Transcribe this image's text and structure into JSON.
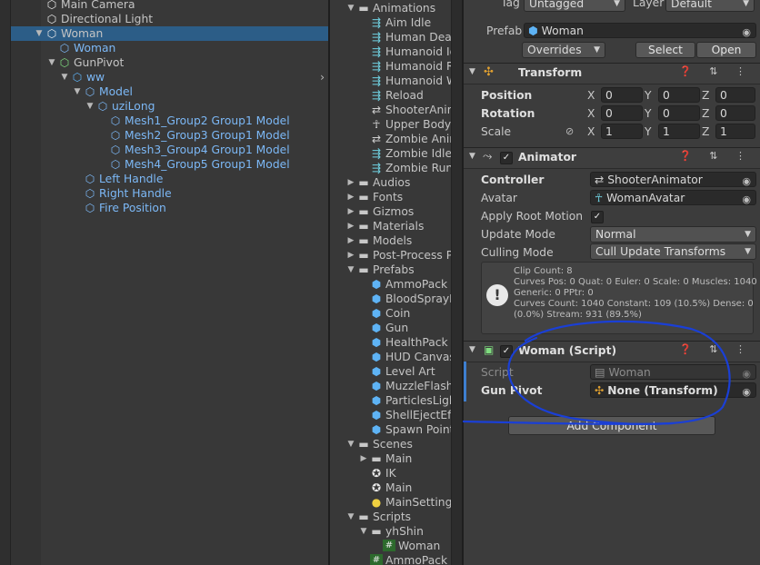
{
  "hierarchy": {
    "items": [
      {
        "label": "Main Camera",
        "indent": 0,
        "arrow": "",
        "icon": "cube",
        "blue": false,
        "selected": false
      },
      {
        "label": "Directional Light",
        "indent": 0,
        "arrow": "",
        "icon": "cube",
        "blue": false,
        "selected": false
      },
      {
        "label": "Woman",
        "indent": 0,
        "arrow": "▼",
        "icon": "cube",
        "blue": false,
        "selected": true
      },
      {
        "label": "Woman",
        "indent": 1,
        "arrow": "",
        "icon": "cube",
        "blue": true,
        "selected": false
      },
      {
        "label": "GunPivot",
        "indent": 1,
        "arrow": "▼",
        "icon": "cube-script",
        "blue": false,
        "selected": false
      },
      {
        "label": "ww",
        "indent": 2,
        "arrow": "▼",
        "icon": "cube-blue",
        "blue": true,
        "selected": false
      },
      {
        "label": "Model",
        "indent": 3,
        "arrow": "▼",
        "icon": "cube",
        "blue": true,
        "selected": false
      },
      {
        "label": "uziLong",
        "indent": 4,
        "arrow": "▼",
        "icon": "cube",
        "blue": true,
        "selected": false
      },
      {
        "label": "Mesh1_Group2 Group1 Model",
        "indent": 5,
        "arrow": "",
        "icon": "cube",
        "blue": true,
        "selected": false
      },
      {
        "label": "Mesh2_Group3 Group1 Model",
        "indent": 5,
        "arrow": "",
        "icon": "cube",
        "blue": true,
        "selected": false
      },
      {
        "label": "Mesh3_Group4 Group1 Model",
        "indent": 5,
        "arrow": "",
        "icon": "cube",
        "blue": true,
        "selected": false
      },
      {
        "label": "Mesh4_Group5 Group1 Model",
        "indent": 5,
        "arrow": "",
        "icon": "cube",
        "blue": true,
        "selected": false
      },
      {
        "label": "Left Handle",
        "indent": 3,
        "arrow": "",
        "icon": "cube",
        "blue": true,
        "selected": false
      },
      {
        "label": "Right Handle",
        "indent": 3,
        "arrow": "",
        "icon": "cube",
        "blue": true,
        "selected": false
      },
      {
        "label": "Fire Position",
        "indent": 3,
        "arrow": "",
        "icon": "cube",
        "blue": true,
        "selected": false
      }
    ],
    "expand_arrow": "›"
  },
  "project": {
    "items": [
      {
        "label": "Animations",
        "indent": 0,
        "arrow": "▼",
        "icon": "folder"
      },
      {
        "label": "Aim Idle",
        "indent": 1,
        "arrow": "",
        "icon": "anim"
      },
      {
        "label": "Human Deat",
        "indent": 1,
        "arrow": "",
        "icon": "anim"
      },
      {
        "label": "Humanoid Id",
        "indent": 1,
        "arrow": "",
        "icon": "anim"
      },
      {
        "label": "Humanoid R",
        "indent": 1,
        "arrow": "",
        "icon": "anim"
      },
      {
        "label": "Humanoid W",
        "indent": 1,
        "arrow": "",
        "icon": "anim"
      },
      {
        "label": "Reload",
        "indent": 1,
        "arrow": "",
        "icon": "anim"
      },
      {
        "label": "ShooterAnim",
        "indent": 1,
        "arrow": "",
        "icon": "animator"
      },
      {
        "label": "Upper Body",
        "indent": 1,
        "arrow": "",
        "icon": "avatar"
      },
      {
        "label": "Zombie Anim",
        "indent": 1,
        "arrow": "",
        "icon": "animator"
      },
      {
        "label": "Zombie Idle",
        "indent": 1,
        "arrow": "",
        "icon": "anim"
      },
      {
        "label": "Zombie Run",
        "indent": 1,
        "arrow": "",
        "icon": "anim"
      },
      {
        "label": "Audios",
        "indent": 0,
        "arrow": "▶",
        "icon": "folder"
      },
      {
        "label": "Fonts",
        "indent": 0,
        "arrow": "▶",
        "icon": "folder"
      },
      {
        "label": "Gizmos",
        "indent": 0,
        "arrow": "▶",
        "icon": "folder"
      },
      {
        "label": "Materials",
        "indent": 0,
        "arrow": "▶",
        "icon": "folder"
      },
      {
        "label": "Models",
        "indent": 0,
        "arrow": "▶",
        "icon": "folder"
      },
      {
        "label": "Post-Process P",
        "indent": 0,
        "arrow": "▶",
        "icon": "folder"
      },
      {
        "label": "Prefabs",
        "indent": 0,
        "arrow": "▼",
        "icon": "folder"
      },
      {
        "label": "AmmoPack",
        "indent": 1,
        "arrow": "",
        "icon": "prefab"
      },
      {
        "label": "BloodSprayE",
        "indent": 1,
        "arrow": "",
        "icon": "prefab"
      },
      {
        "label": "Coin",
        "indent": 1,
        "arrow": "",
        "icon": "prefab"
      },
      {
        "label": "Gun",
        "indent": 1,
        "arrow": "",
        "icon": "prefab"
      },
      {
        "label": "HealthPack",
        "indent": 1,
        "arrow": "",
        "icon": "prefab"
      },
      {
        "label": "HUD Canvas",
        "indent": 1,
        "arrow": "",
        "icon": "prefab"
      },
      {
        "label": "Level Art",
        "indent": 1,
        "arrow": "",
        "icon": "prefab"
      },
      {
        "label": "MuzzleFlash",
        "indent": 1,
        "arrow": "",
        "icon": "prefab"
      },
      {
        "label": "ParticlesLigh",
        "indent": 1,
        "arrow": "",
        "icon": "prefab"
      },
      {
        "label": "ShellEjectEff",
        "indent": 1,
        "arrow": "",
        "icon": "prefab"
      },
      {
        "label": "Spawn Point",
        "indent": 1,
        "arrow": "",
        "icon": "prefab"
      },
      {
        "label": "Scenes",
        "indent": 0,
        "arrow": "▼",
        "icon": "folder"
      },
      {
        "label": "Main",
        "indent": 1,
        "arrow": "▶",
        "icon": "folder"
      },
      {
        "label": "IK",
        "indent": 1,
        "arrow": "",
        "icon": "unity"
      },
      {
        "label": "Main",
        "indent": 1,
        "arrow": "",
        "icon": "unity"
      },
      {
        "label": "MainSetting",
        "indent": 1,
        "arrow": "",
        "icon": "bulb"
      },
      {
        "label": "Scripts",
        "indent": 0,
        "arrow": "▼",
        "icon": "folder"
      },
      {
        "label": "yhShin",
        "indent": 1,
        "arrow": "▼",
        "icon": "folder"
      },
      {
        "label": "Woman",
        "indent": 2,
        "arrow": "",
        "icon": "script"
      },
      {
        "label": "AmmoPack",
        "indent": 1,
        "arrow": "",
        "icon": "script"
      }
    ]
  },
  "inspector": {
    "tag_label": "Tag",
    "tag_value": "Untagged",
    "layer_label": "Layer",
    "layer_value": "Default",
    "prefab_label": "Prefab",
    "prefab_value": "Woman",
    "overrides_label": "Overrides",
    "select_label": "Select",
    "open_label": "Open",
    "transform": {
      "title": "Transform",
      "position_label": "Position",
      "rotation_label": "Rotation",
      "scale_label": "Scale",
      "x": "X",
      "y": "Y",
      "z": "Z",
      "position": [
        "0",
        "0",
        "0"
      ],
      "rotation": [
        "0",
        "0",
        "0"
      ],
      "scale": [
        "1",
        "1",
        "1"
      ]
    },
    "animator": {
      "title": "Animator",
      "controller_label": "Controller",
      "controller_value": "ShooterAnimator",
      "avatar_label": "Avatar",
      "avatar_value": "WomanAvatar",
      "apply_root_motion_label": "Apply Root Motion",
      "apply_root_motion": true,
      "update_mode_label": "Update Mode",
      "update_mode_value": "Normal",
      "culling_mode_label": "Culling Mode",
      "culling_mode_value": "Cull Update Transforms",
      "info_text": "Clip Count: 8\nCurves Pos: 0 Quat: 0 Euler: 0 Scale: 0 Muscles: 1040\nGeneric: 0 PPtr: 0\nCurves Count: 1040 Constant: 109 (10.5%) Dense: 0\n(0.0%) Stream: 931 (89.5%)"
    },
    "script": {
      "title": "Woman (Script)",
      "script_label": "Script",
      "script_value": "Woman",
      "gun_pivot_label": "Gun Pivot",
      "gun_pivot_value": "None (Transform)"
    },
    "add_component_label": "Add Component",
    "header_icons": "❓ ⇅ ⋮"
  },
  "colors": {
    "selection": "#2c5d87",
    "prefab_blue": "#7cb8f6",
    "annotation_ink": "#1a3fd6"
  }
}
